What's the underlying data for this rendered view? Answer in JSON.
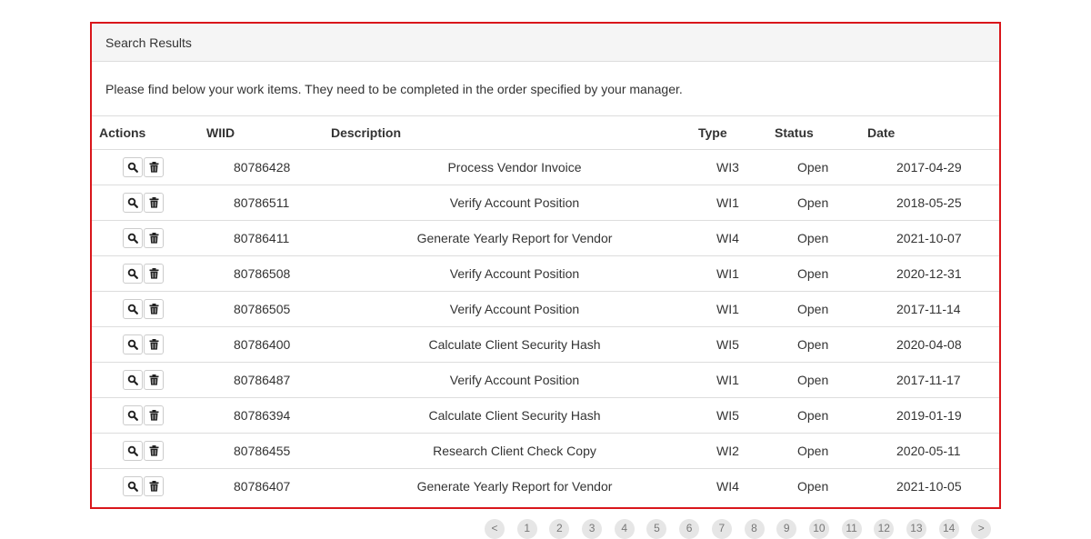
{
  "panel": {
    "heading": "Search Results",
    "instructions": "Please find below your work items. They need to be completed in the order specified by your manager."
  },
  "table": {
    "headers": [
      "Actions",
      "WIID",
      "Description",
      "Type",
      "Status",
      "Date"
    ],
    "rows": [
      {
        "wiid": "80786428",
        "description": "Process Vendor Invoice",
        "type": "WI3",
        "status": "Open",
        "date": "2017-04-29"
      },
      {
        "wiid": "80786511",
        "description": "Verify Account Position",
        "type": "WI1",
        "status": "Open",
        "date": "2018-05-25"
      },
      {
        "wiid": "80786411",
        "description": "Generate Yearly Report for Vendor",
        "type": "WI4",
        "status": "Open",
        "date": "2021-10-07"
      },
      {
        "wiid": "80786508",
        "description": "Verify Account Position",
        "type": "WI1",
        "status": "Open",
        "date": "2020-12-31"
      },
      {
        "wiid": "80786505",
        "description": "Verify Account Position",
        "type": "WI1",
        "status": "Open",
        "date": "2017-11-14"
      },
      {
        "wiid": "80786400",
        "description": "Calculate Client Security Hash",
        "type": "WI5",
        "status": "Open",
        "date": "2020-04-08"
      },
      {
        "wiid": "80786487",
        "description": "Verify Account Position",
        "type": "WI1",
        "status": "Open",
        "date": "2017-11-17"
      },
      {
        "wiid": "80786394",
        "description": "Calculate Client Security Hash",
        "type": "WI5",
        "status": "Open",
        "date": "2019-01-19"
      },
      {
        "wiid": "80786455",
        "description": "Research Client Check Copy",
        "type": "WI2",
        "status": "Open",
        "date": "2020-05-11"
      },
      {
        "wiid": "80786407",
        "description": "Generate Yearly Report for Vendor",
        "type": "WI4",
        "status": "Open",
        "date": "2021-10-05"
      }
    ],
    "row_action_icons": [
      "search-icon",
      "trash-icon"
    ]
  },
  "pagination": {
    "items": [
      "<",
      "1",
      "2",
      "3",
      "4",
      "5",
      "6",
      "7",
      "8",
      "9",
      "10",
      "11",
      "12",
      "13",
      "14",
      ">"
    ]
  },
  "colors": {
    "panel_border": "#d9161b",
    "heading_background": "#f5f5f5"
  }
}
